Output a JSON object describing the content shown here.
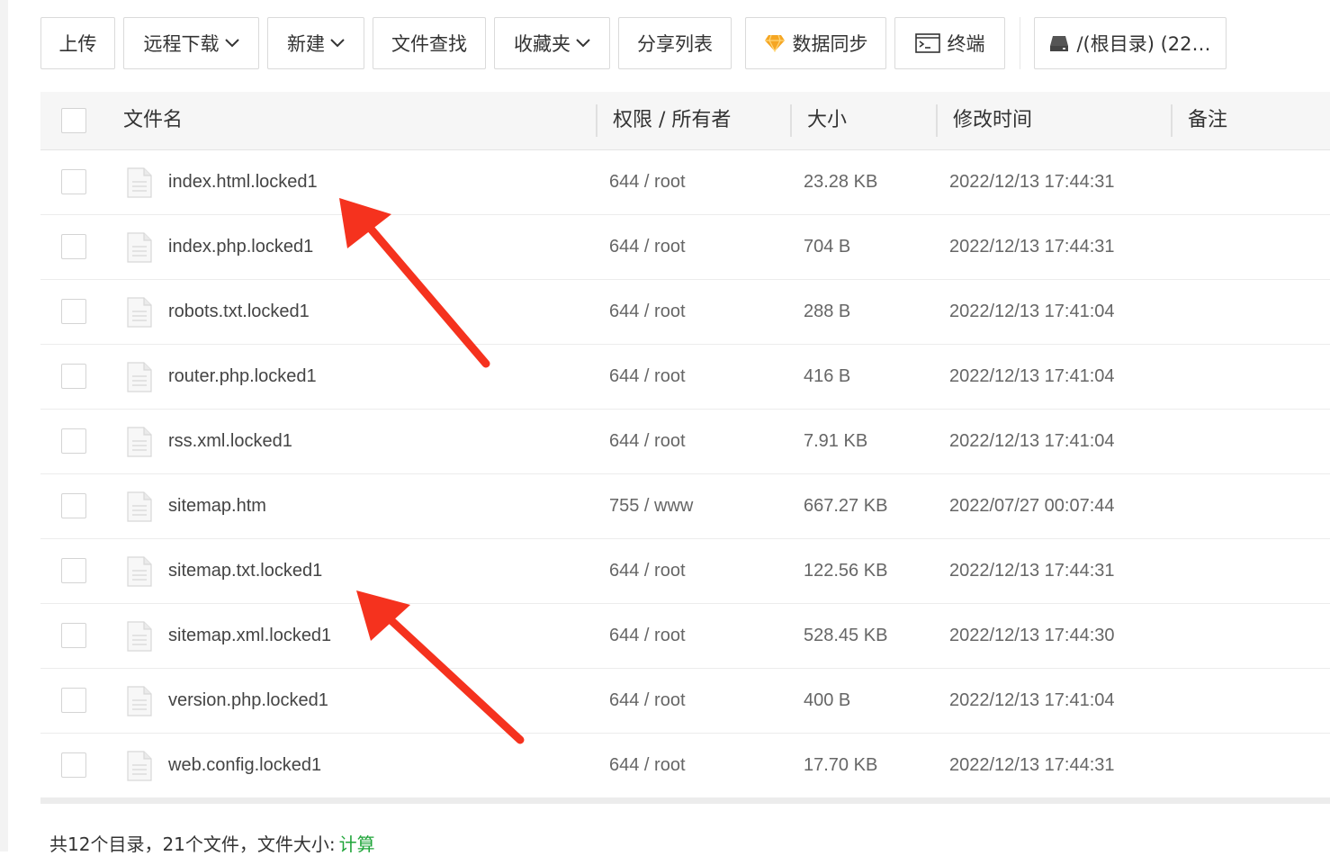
{
  "toolbar": {
    "upload": "上传",
    "remote_download": "远程下载",
    "new": "新建",
    "file_search": "文件查找",
    "favorites": "收藏夹",
    "share_list": "分享列表",
    "data_sync": "数据同步",
    "terminal": "终端",
    "root_dir": "/(根目录) (22…"
  },
  "table": {
    "headers": {
      "name": "文件名",
      "perm": "权限 / 所有者",
      "size": "大小",
      "mtime": "修改时间",
      "note": "备注"
    },
    "rows": [
      {
        "name": "index.html.locked1",
        "perm": "644 / root",
        "size": "23.28 KB",
        "mtime": "2022/12/13 17:44:31"
      },
      {
        "name": "index.php.locked1",
        "perm": "644 / root",
        "size": "704 B",
        "mtime": "2022/12/13 17:44:31"
      },
      {
        "name": "robots.txt.locked1",
        "perm": "644 / root",
        "size": "288 B",
        "mtime": "2022/12/13 17:41:04"
      },
      {
        "name": "router.php.locked1",
        "perm": "644 / root",
        "size": "416 B",
        "mtime": "2022/12/13 17:41:04"
      },
      {
        "name": "rss.xml.locked1",
        "perm": "644 / root",
        "size": "7.91 KB",
        "mtime": "2022/12/13 17:41:04"
      },
      {
        "name": "sitemap.htm",
        "perm": "755 / www",
        "size": "667.27 KB",
        "mtime": "2022/07/27 00:07:44"
      },
      {
        "name": "sitemap.txt.locked1",
        "perm": "644 / root",
        "size": "122.56 KB",
        "mtime": "2022/12/13 17:44:31"
      },
      {
        "name": "sitemap.xml.locked1",
        "perm": "644 / root",
        "size": "528.45 KB",
        "mtime": "2022/12/13 17:44:30"
      },
      {
        "name": "version.php.locked1",
        "perm": "644 / root",
        "size": "400 B",
        "mtime": "2022/12/13 17:41:04"
      },
      {
        "name": "web.config.locked1",
        "perm": "644 / root",
        "size": "17.70 KB",
        "mtime": "2022/12/13 17:44:31"
      }
    ]
  },
  "footer": {
    "summary": "共12个目录，21个文件，文件大小:",
    "calc_link": "计算"
  },
  "colors": {
    "accent_green": "#20a53a",
    "annotation_arrow": "#f5321e",
    "gem": "#f5a623"
  }
}
